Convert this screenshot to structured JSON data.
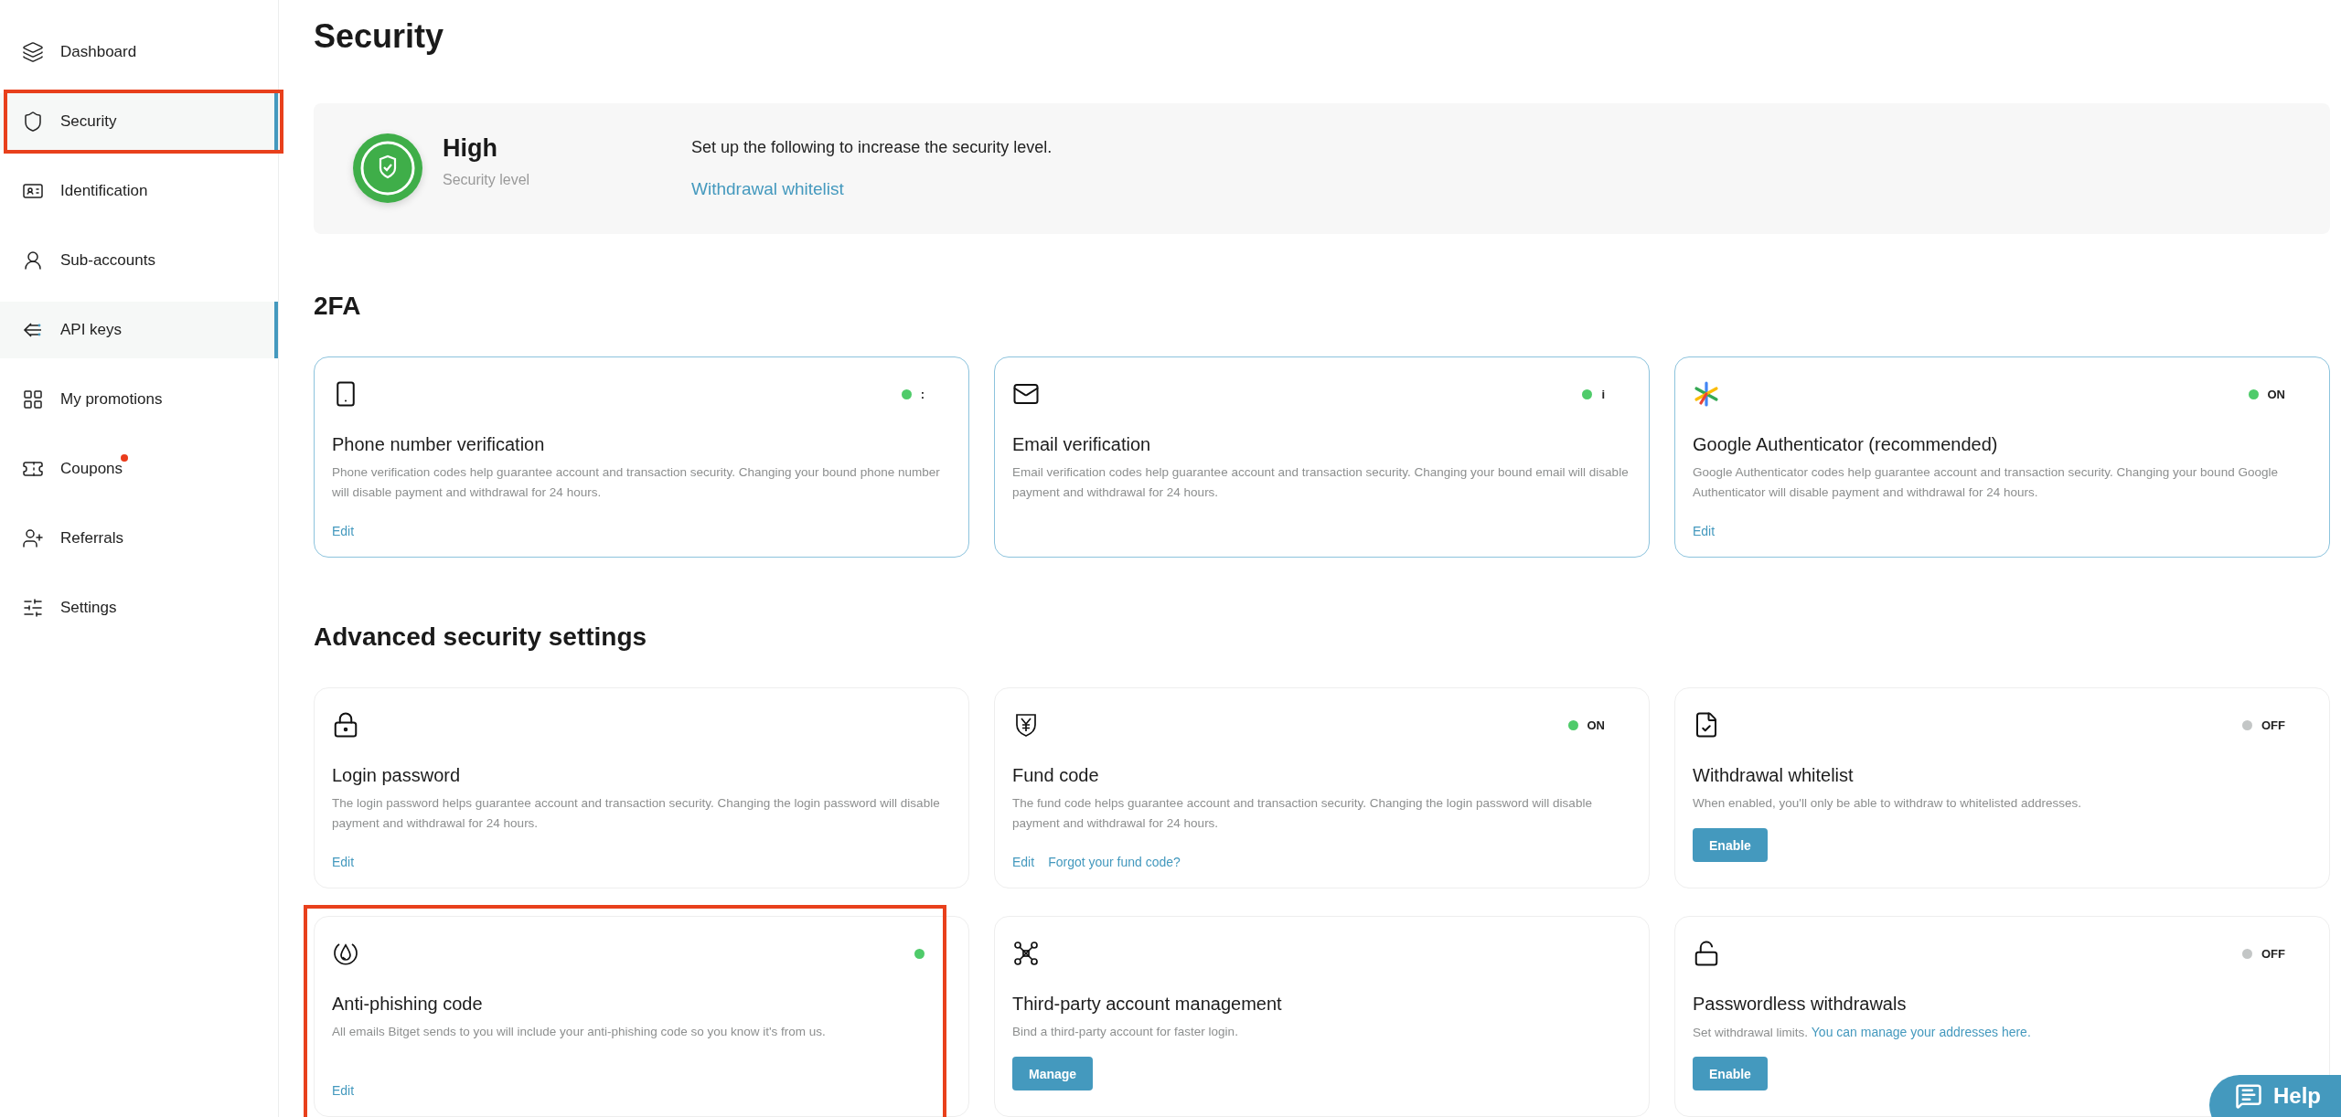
{
  "sidebar": {
    "items": [
      {
        "label": "Dashboard",
        "selected": false,
        "highlighted": false,
        "badge": false
      },
      {
        "label": "Security",
        "selected": true,
        "highlighted": true,
        "badge": false
      },
      {
        "label": "Identification",
        "selected": false,
        "highlighted": false,
        "badge": false
      },
      {
        "label": "Sub-accounts",
        "selected": false,
        "highlighted": false,
        "badge": false
      },
      {
        "label": "API keys",
        "selected": true,
        "highlighted": false,
        "badge": false
      },
      {
        "label": "My promotions",
        "selected": false,
        "highlighted": false,
        "badge": false
      },
      {
        "label": "Coupons",
        "selected": false,
        "highlighted": false,
        "badge": true
      },
      {
        "label": "Referrals",
        "selected": false,
        "highlighted": false,
        "badge": false
      },
      {
        "label": "Settings",
        "selected": false,
        "highlighted": false,
        "badge": false
      }
    ]
  },
  "page_title": "Security",
  "summary": {
    "level": "High",
    "level_label": "Security level",
    "prompt": "Set up the following to increase the security level.",
    "link": "Withdrawal whitelist"
  },
  "sections": [
    {
      "title": "2FA",
      "cards": [
        {
          "title": "Phone number verification",
          "description": "Phone verification codes help guarantee account and transaction security. Changing your bound phone number will disable payment and withdrawal for 24 hours.",
          "status": {
            "on": true,
            "text": ":"
          },
          "actions": [
            {
              "kind": "link",
              "label": "Edit"
            }
          ],
          "highlighted": false
        },
        {
          "title": "Email verification",
          "description": "Email verification codes help guarantee account and transaction security. Changing your bound email will disable payment and withdrawal for 24 hours.",
          "status": {
            "on": true,
            "text": "i"
          },
          "highlighted": false
        },
        {
          "title": "Google Authenticator (recommended)",
          "description": "Google Authenticator codes help guarantee account and transaction security. Changing your bound Google Authenticator will disable payment and withdrawal for 24 hours.",
          "status": {
            "on": true,
            "text": "ON"
          },
          "actions": [
            {
              "kind": "link",
              "label": "Edit"
            }
          ],
          "highlighted": false
        }
      ]
    },
    {
      "title": "Advanced security settings",
      "cards": [
        {
          "title": "Login password",
          "description": "The login password helps guarantee account and transaction security. Changing the login password will disable payment and withdrawal for 24 hours.",
          "actions": [
            {
              "kind": "link",
              "label": "Edit"
            }
          ],
          "highlighted": false
        },
        {
          "title": "Fund code",
          "description": "The fund code helps guarantee account and transaction security. Changing the login password will disable payment and withdrawal for 24 hours.",
          "status": {
            "on": true,
            "text": "ON"
          },
          "actions": [
            {
              "kind": "link",
              "label": "Edit"
            },
            {
              "kind": "link",
              "label": "Forgot your fund code?"
            }
          ],
          "highlighted": false
        },
        {
          "title": "Withdrawal whitelist",
          "description": "When enabled, you'll only be able to withdraw to whitelisted addresses.",
          "status": {
            "on": false,
            "text": "OFF"
          },
          "actions": [
            {
              "kind": "button",
              "label": "Enable"
            }
          ],
          "highlighted": false
        },
        {
          "title": "Anti-phishing code",
          "description": "All emails Bitget sends to you will include your anti-phishing code so you know it's from us.",
          "status": {
            "on": true
          },
          "actions": [
            {
              "kind": "link",
              "label": "Edit"
            }
          ],
          "highlighted": true
        },
        {
          "title": "Third-party account management",
          "description": "Bind a third-party account for faster login.",
          "actions": [
            {
              "kind": "button",
              "label": "Manage"
            }
          ],
          "highlighted": false
        },
        {
          "title": "Passwordless withdrawals",
          "description": "Set withdrawal limits.",
          "description_link": "You can manage your addresses here.",
          "status": {
            "on": false,
            "text": "OFF"
          },
          "actions": [
            {
              "kind": "button",
              "label": "Enable"
            }
          ],
          "highlighted": false
        }
      ]
    }
  ],
  "help_button": "Help"
}
